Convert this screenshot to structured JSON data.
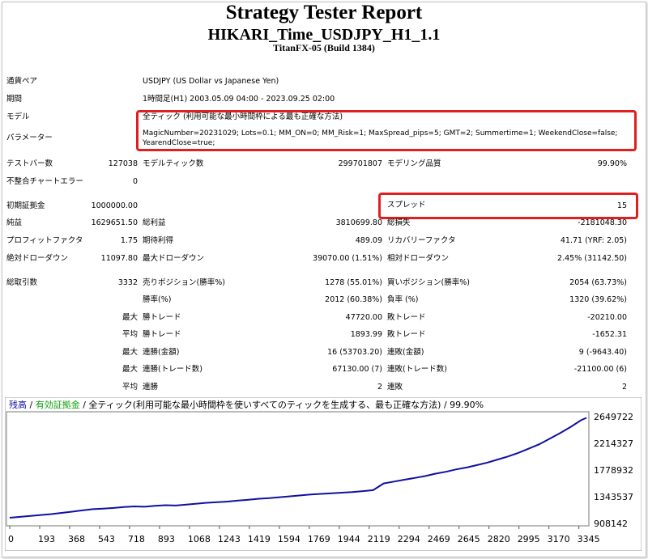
{
  "report": {
    "title": "Strategy Tester Report",
    "ea_name": "HIKARI_Time_USDJPY_H1_1.1",
    "build": "TitanFX-05 (Build 1384)"
  },
  "info": {
    "symbol_label": "通貨ペア",
    "symbol": "USDJPY (US Dollar vs Japanese Yen)",
    "period_label": "期間",
    "period": "1時間足(H1) 2003.05.09 04:00 - 2023.09.25 02:00",
    "model_label": "モデル",
    "model": "全ティック (利用可能な最小時間枠による最も正確な方法)",
    "params_label": "パラメーター",
    "params_line1": "MagicNumber=20231029; Lots=0.1; MM_ON=0; MM_Risk=1; MaxSpread_pips=5; GMT=2; Summertime=1; WeekendClose=false;",
    "params_line2": "YearendClose=true;"
  },
  "stats": {
    "bars_label": "テストバー数",
    "bars": "127038",
    "ticks_label": "モデルティック数",
    "ticks": "299701807",
    "quality_label": "モデリング品質",
    "quality": "99.90%",
    "mismatch_label": "不整合チャートエラー",
    "mismatch": "0",
    "deposit_label": "初期証拠金",
    "deposit": "1000000.00",
    "spread_label": "スプレッド",
    "spread": "15",
    "net_label": "純益",
    "net": "1629651.50",
    "gross_profit_label": "総利益",
    "gross_profit": "3810699.80",
    "gross_loss_label": "総損失",
    "gross_loss": "-2181048.30",
    "pf_label": "プロフィットファクタ",
    "pf": "1.75",
    "payoff_label": "期待利得",
    "payoff": "489.09",
    "recovery_label": "リカバリーファクタ",
    "recovery": "41.71 (YRF: 2.05)",
    "abs_dd_label": "絶対ドローダウン",
    "abs_dd": "11097.80",
    "max_dd_label": "最大ドローダウン",
    "max_dd": "39070.00 (1.51%)",
    "rel_dd_label": "相対ドローダウン",
    "rel_dd": "2.45% (31142.50)",
    "trades_label": "総取引数",
    "trades": "3332",
    "short_label": "売りポジション(勝率%)",
    "short": "1278 (55.01%)",
    "long_label": "買いポジション(勝率%)",
    "long": "2054 (63.73%)",
    "win_label": "勝率(%)",
    "win": "2012 (60.38%)",
    "loss_label": "負率 (%)",
    "loss": "1320 (39.62%)",
    "max_label": "最大",
    "avg_label": "平均",
    "max_win_label": "勝トレード",
    "max_win": "47720.00",
    "max_loss_label": "敗トレード",
    "max_loss": "-20210.00",
    "avg_win_label": "勝トレード",
    "avg_win": "1893.99",
    "avg_loss_label": "敗トレード",
    "avg_loss": "-1652.31",
    "cons_win_amt_label": "連勝(金額)",
    "cons_win_amt": "16 (53703.20)",
    "cons_loss_amt_label": "連敗(金額)",
    "cons_loss_amt": "9 (-9643.40)",
    "cons_win_trd_label": "連勝(トレード数)",
    "cons_win_trd": "67130.00 (7)",
    "cons_loss_trd_label": "連敗(トレード数)",
    "cons_loss_trd": "-21100.00 (6)",
    "avg_cons_win_label": "連勝",
    "avg_cons_win": "2",
    "avg_cons_loss_label": "連敗",
    "avg_cons_loss": "2"
  },
  "chart_data": {
    "type": "line",
    "legend_balance": "残高",
    "legend_sep1": " / ",
    "legend_equity": "有効証拠金",
    "legend_rest": " / 全ティック(利用可能な最小時間枠を使いすべてのティックを生成する、最も正確な方法) / 99.90%",
    "x_ticks": [
      "0",
      "193",
      "368",
      "543",
      "718",
      "893",
      "1068",
      "1243",
      "1419",
      "1594",
      "1769",
      "1944",
      "2119",
      "2294",
      "2469",
      "2645",
      "2820",
      "2995",
      "3170",
      "3345"
    ],
    "y_ticks": [
      "2649722",
      "2214327",
      "1778932",
      "1343537",
      "908142"
    ],
    "xlim": [
      0,
      3332
    ],
    "ylim": [
      908142,
      2649722
    ],
    "series_color": "#1010a0",
    "balance_color": "#1010a0",
    "equity_color": "#10a010",
    "x": [
      0,
      60,
      120,
      180,
      240,
      300,
      360,
      420,
      480,
      540,
      600,
      660,
      720,
      780,
      840,
      900,
      960,
      1020,
      1080,
      1140,
      1200,
      1260,
      1320,
      1380,
      1440,
      1500,
      1560,
      1620,
      1680,
      1740,
      1800,
      1860,
      1920,
      1980,
      2040,
      2100,
      2160,
      2220,
      2280,
      2340,
      2400,
      2460,
      2520,
      2580,
      2640,
      2700,
      2760,
      2820,
      2880,
      2940,
      3000,
      3060,
      3120,
      3180,
      3240,
      3300,
      3332
    ],
    "y": [
      1000000,
      1015000,
      1030000,
      1045000,
      1060000,
      1080000,
      1100000,
      1120000,
      1140000,
      1150000,
      1160000,
      1175000,
      1185000,
      1180000,
      1195000,
      1205000,
      1200000,
      1215000,
      1230000,
      1245000,
      1255000,
      1265000,
      1280000,
      1295000,
      1310000,
      1320000,
      1335000,
      1350000,
      1365000,
      1380000,
      1390000,
      1400000,
      1410000,
      1420000,
      1435000,
      1450000,
      1560000,
      1590000,
      1620000,
      1650000,
      1680000,
      1720000,
      1750000,
      1790000,
      1820000,
      1860000,
      1900000,
      1950000,
      2000000,
      2060000,
      2130000,
      2200000,
      2290000,
      2380000,
      2480000,
      2590000,
      2629650
    ]
  }
}
